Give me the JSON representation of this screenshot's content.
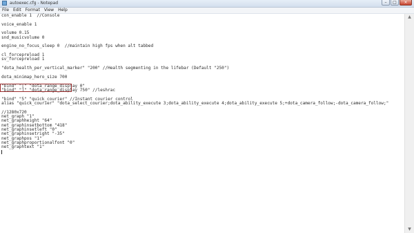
{
  "window": {
    "title": "autoexec.cfg - Notepad",
    "controls": {
      "minimize": "–",
      "maximize": "□",
      "close": "×"
    }
  },
  "menu": [
    "File",
    "Edit",
    "Format",
    "View",
    "Help"
  ],
  "editor": {
    "lines": [
      "con_enable 1  //Console",
      "",
      "voice_enable 1",
      "",
      "volume 0.15",
      "snd_musicvolume 0",
      "",
      "engine_no_focus_sleep 0  //maintain high fps when alt tabbed",
      "",
      "cl_forcepreload 1",
      "sv_forcepreload 1",
      "",
      "\"dota_health_per_vertical_marker\" \"200\" //Health segmenting in the lifebar (Default \"250\")",
      "",
      "dota_minimap_hero_size 700",
      "",
      "\"bind\" \"[\" \"dota_range_display 0\"",
      "\"bind\" \"]\" \"dota_range_display 750\" //leshrac",
      "",
      "\"bind\" \"5\" \"quick_courier\" //Instant courier control",
      "alias \"quick_courier\" \"dota_select_courier;dota_ability_execute 3;dota_ability_execute 4;dota_ability_execute 5;+dota_camera_follow;-dota_camera_follow;\"",
      "",
      "//1280x720",
      "net_graph \"1\"",
      "net_graphheight \"64\"",
      "net_graphinsetbottom \"418\"",
      "net_graphinsetleft \"0\"",
      "net_graphinsetright \"-35\"",
      "net_graphpos \"1\"",
      "net_graphproportionalfont \"0\"",
      "net_graphtext \"1\""
    ]
  }
}
